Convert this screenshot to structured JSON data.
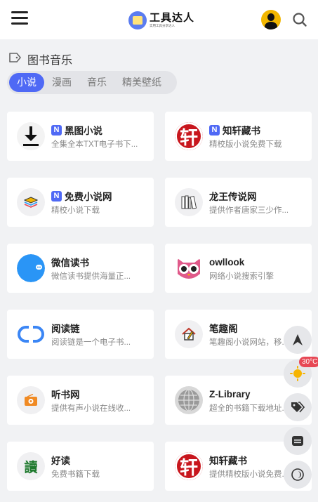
{
  "header": {
    "logo_title": "工具达人",
    "logo_subtitle": "实用工具分享达人"
  },
  "category": {
    "title": "图书音乐",
    "tabs": [
      "小说",
      "漫画",
      "音乐",
      "精美壁纸"
    ],
    "active_tab": "小说"
  },
  "cards": [
    {
      "name": "黑图小说",
      "desc": "全集全本TXT电子书下...",
      "badge": "N",
      "icon": "download-icon"
    },
    {
      "name": "知轩藏书",
      "desc": "精校版小说免费下载",
      "badge": "N",
      "icon": "xuan-icon"
    },
    {
      "name": "免费小说网",
      "desc": "精校小说下载",
      "badge": "N",
      "icon": "layers-icon"
    },
    {
      "name": "龙王传说网",
      "desc": "提供作者唐家三少作...",
      "badge": "",
      "icon": "books-icon"
    },
    {
      "name": "微信读书",
      "desc": "微信读书提供海量正...",
      "badge": "",
      "icon": "chat-bubble-icon"
    },
    {
      "name": "owllook",
      "desc": "网络小说搜索引擎",
      "badge": "",
      "icon": "owl-icon"
    },
    {
      "name": "阅读链",
      "desc": "阅读链是一个电子书...",
      "badge": "",
      "icon": "link-icon"
    },
    {
      "name": "笔趣阁",
      "desc": "笔趣阁小说网站，移...",
      "badge": "",
      "icon": "house-pen-icon"
    },
    {
      "name": "听书网",
      "desc": "提供有声小说在线收...",
      "badge": "",
      "icon": "radio-icon"
    },
    {
      "name": "Z-Library",
      "desc": "超全的书籍下载地址...",
      "badge": "",
      "icon": "globe-icon"
    },
    {
      "name": "好读",
      "desc": "免费书籍下载",
      "badge": "",
      "icon": "du-icon"
    },
    {
      "name": "知轩藏书",
      "desc": "提供精校版小说免费...",
      "badge": "",
      "icon": "xuan-icon"
    }
  ],
  "floating": {
    "temperature": "30°C"
  },
  "colors": {
    "accent": "#4f69f5",
    "badge_red": "#e74855"
  }
}
